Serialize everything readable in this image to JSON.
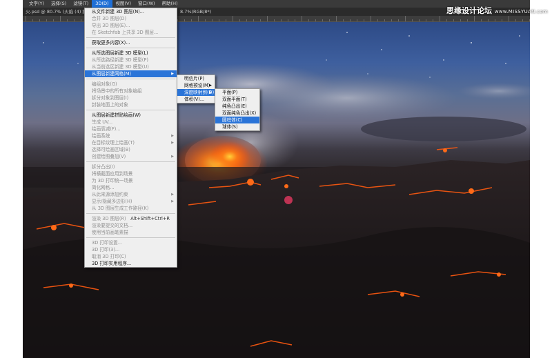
{
  "menubar": {
    "items": [
      "文字(Y)",
      "选择(S)",
      "滤镜(T)",
      "3D(D)",
      "视图(V)",
      "窗口(W)",
      "帮助(H)"
    ],
    "active_index": 3
  },
  "document_tab": {
    "left": "火.psd @ 80.7% (火焰 (4) 拷",
    "right": "8.7%(RGB/8*)"
  },
  "watermark": {
    "main": "思缘设计论坛",
    "url": "www.MISSYUAN.com"
  },
  "menu_3d": {
    "sections": [
      [
        {
          "label": "从文件新建 3D 图层(N)...",
          "disabled": false
        },
        {
          "label": "合并 3D 图层(D)",
          "disabled": true
        },
        {
          "label": "导出 3D 图层(E)...",
          "disabled": true
        },
        {
          "label": "在 Sketchfab 上共享 3D 图层...",
          "disabled": true
        }
      ],
      [
        {
          "label": "获取更多内容(X)...",
          "disabled": false
        }
      ],
      [
        {
          "label": "从所选图层新建 3D 模型(L)",
          "disabled": false
        },
        {
          "label": "从所选路径新建 3D 模型(P)",
          "disabled": true
        },
        {
          "label": "从当前选区新建 3D 模型(U)",
          "disabled": true
        },
        {
          "label": "从图层新建网格(M)",
          "disabled": false,
          "submenu": true,
          "highlight": true
        }
      ],
      [
        {
          "label": "编组对象(G)",
          "disabled": true
        },
        {
          "label": "将场景中的所有对象编组",
          "disabled": true
        },
        {
          "label": "拆分对象到图层(I)",
          "disabled": true
        },
        {
          "label": "封装地面上的对象",
          "disabled": true
        }
      ],
      [
        {
          "label": "从图层新建拼贴绘画(W)",
          "disabled": false
        },
        {
          "label": "生成 UV...",
          "disabled": true
        },
        {
          "label": "绘画衰减(F)...",
          "disabled": true
        },
        {
          "label": "绘画系统",
          "disabled": true,
          "submenu": true
        },
        {
          "label": "在目标纹理上绘画(T)",
          "disabled": true,
          "submenu": true
        },
        {
          "label": "选择可绘画区域(B)",
          "disabled": true
        },
        {
          "label": "创建绘图叠加(V)",
          "disabled": true,
          "submenu": true
        }
      ],
      [
        {
          "label": "拆分凸出(I)",
          "disabled": true
        },
        {
          "label": "将横截面应用到场景",
          "disabled": true
        },
        {
          "label": "为 3D 打印统一场景",
          "disabled": true
        },
        {
          "label": "简化网格...",
          "disabled": true
        },
        {
          "label": "从此来源添加约束",
          "disabled": true,
          "submenu": true
        },
        {
          "label": "显示/隐藏多边形(H)",
          "disabled": true,
          "submenu": true
        },
        {
          "label": "从 3D 图层生成工作路径(K)",
          "disabled": true
        }
      ],
      [
        {
          "label": "渲染 3D 图层(R)",
          "disabled": true,
          "shortcut": "Alt+Shift+Ctrl+R"
        },
        {
          "label": "渲染要提交的文档...",
          "disabled": true
        },
        {
          "label": "使用当前画笔素描",
          "disabled": true
        }
      ],
      [
        {
          "label": "3D 打印设置...",
          "disabled": true
        },
        {
          "label": "3D 打印(3)...",
          "disabled": true
        },
        {
          "label": "取消 3D 打印(C)",
          "disabled": true
        },
        {
          "label": "3D 打印实用程序...",
          "disabled": false
        }
      ]
    ]
  },
  "submenu_mesh": {
    "items": [
      {
        "label": "明信片(P)",
        "highlight": false,
        "submenu": false
      },
      {
        "label": "网格预设(M)",
        "highlight": false,
        "submenu": true
      },
      {
        "label": "深度映射到(D)",
        "highlight": true,
        "submenu": true
      },
      {
        "label": "体积(V)...",
        "highlight": false,
        "submenu": false
      }
    ]
  },
  "submenu_depth": {
    "items": [
      {
        "label": "平面(P)",
        "highlight": false
      },
      {
        "label": "双面平面(T)",
        "highlight": false
      },
      {
        "label": "纯色凸出(E)",
        "highlight": false
      },
      {
        "label": "双面纯色凸出(X)",
        "highlight": false
      },
      {
        "label": "圆柱体(C)",
        "highlight": true
      },
      {
        "label": "球体(S)",
        "highlight": false
      }
    ]
  },
  "colors": {
    "menu_highlight": "#2a74d8",
    "menubar_bg": "#3a3a3a",
    "lava": "#ff5a10"
  }
}
